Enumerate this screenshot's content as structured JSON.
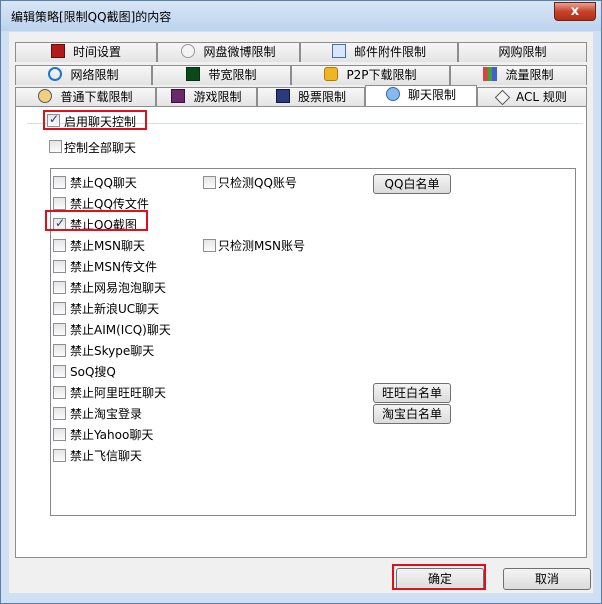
{
  "window": {
    "title": "编辑策略[限制QQ截图]的内容",
    "close_glyph": "x"
  },
  "tabs": {
    "row1": [
      "时间设置",
      "网盘微博限制",
      "邮件附件限制",
      "网购限制"
    ],
    "row2": [
      "网络限制",
      "带宽限制",
      "P2P下载限制",
      "流量限制"
    ],
    "row3": [
      "普通下载限制",
      "游戏限制",
      "股票限制",
      "聊天限制",
      "ACL 规则"
    ],
    "active": "聊天限制"
  },
  "chat": {
    "enable_label": "启用聊天控制",
    "enable_checked": true,
    "control_all_label": "控制全部聊天",
    "control_all_checked": false,
    "items": [
      {
        "label": "禁止QQ聊天",
        "checked": false
      },
      {
        "label": "禁止QQ传文件",
        "checked": false
      },
      {
        "label": "禁止QQ截图",
        "checked": true
      },
      {
        "label": "禁止MSN聊天",
        "checked": false
      },
      {
        "label": "禁止MSN传文件",
        "checked": false
      },
      {
        "label": "禁止网易泡泡聊天",
        "checked": false
      },
      {
        "label": "禁止新浪UC聊天",
        "checked": false
      },
      {
        "label": "禁止AIM(ICQ)聊天",
        "checked": false
      },
      {
        "label": "禁止Skype聊天",
        "checked": false
      },
      {
        "label": "SoQ搜Q",
        "checked": false
      },
      {
        "label": "禁止阿里旺旺聊天",
        "checked": false
      },
      {
        "label": "禁止淘宝登录",
        "checked": false
      },
      {
        "label": "禁止Yahoo聊天",
        "checked": false
      },
      {
        "label": "禁止飞信聊天",
        "checked": false
      }
    ],
    "only_qq_label": "只检测QQ账号",
    "only_msn_label": "只检测MSN账号",
    "qq_whitelist": "QQ白名单",
    "wangwang_whitelist": "旺旺白名单",
    "taobao_whitelist": "淘宝白名单"
  },
  "footer": {
    "ok": "确定",
    "cancel": "取消"
  },
  "colors": {
    "highlight": "#e0101a",
    "title_bg": "#cfe0f3"
  }
}
